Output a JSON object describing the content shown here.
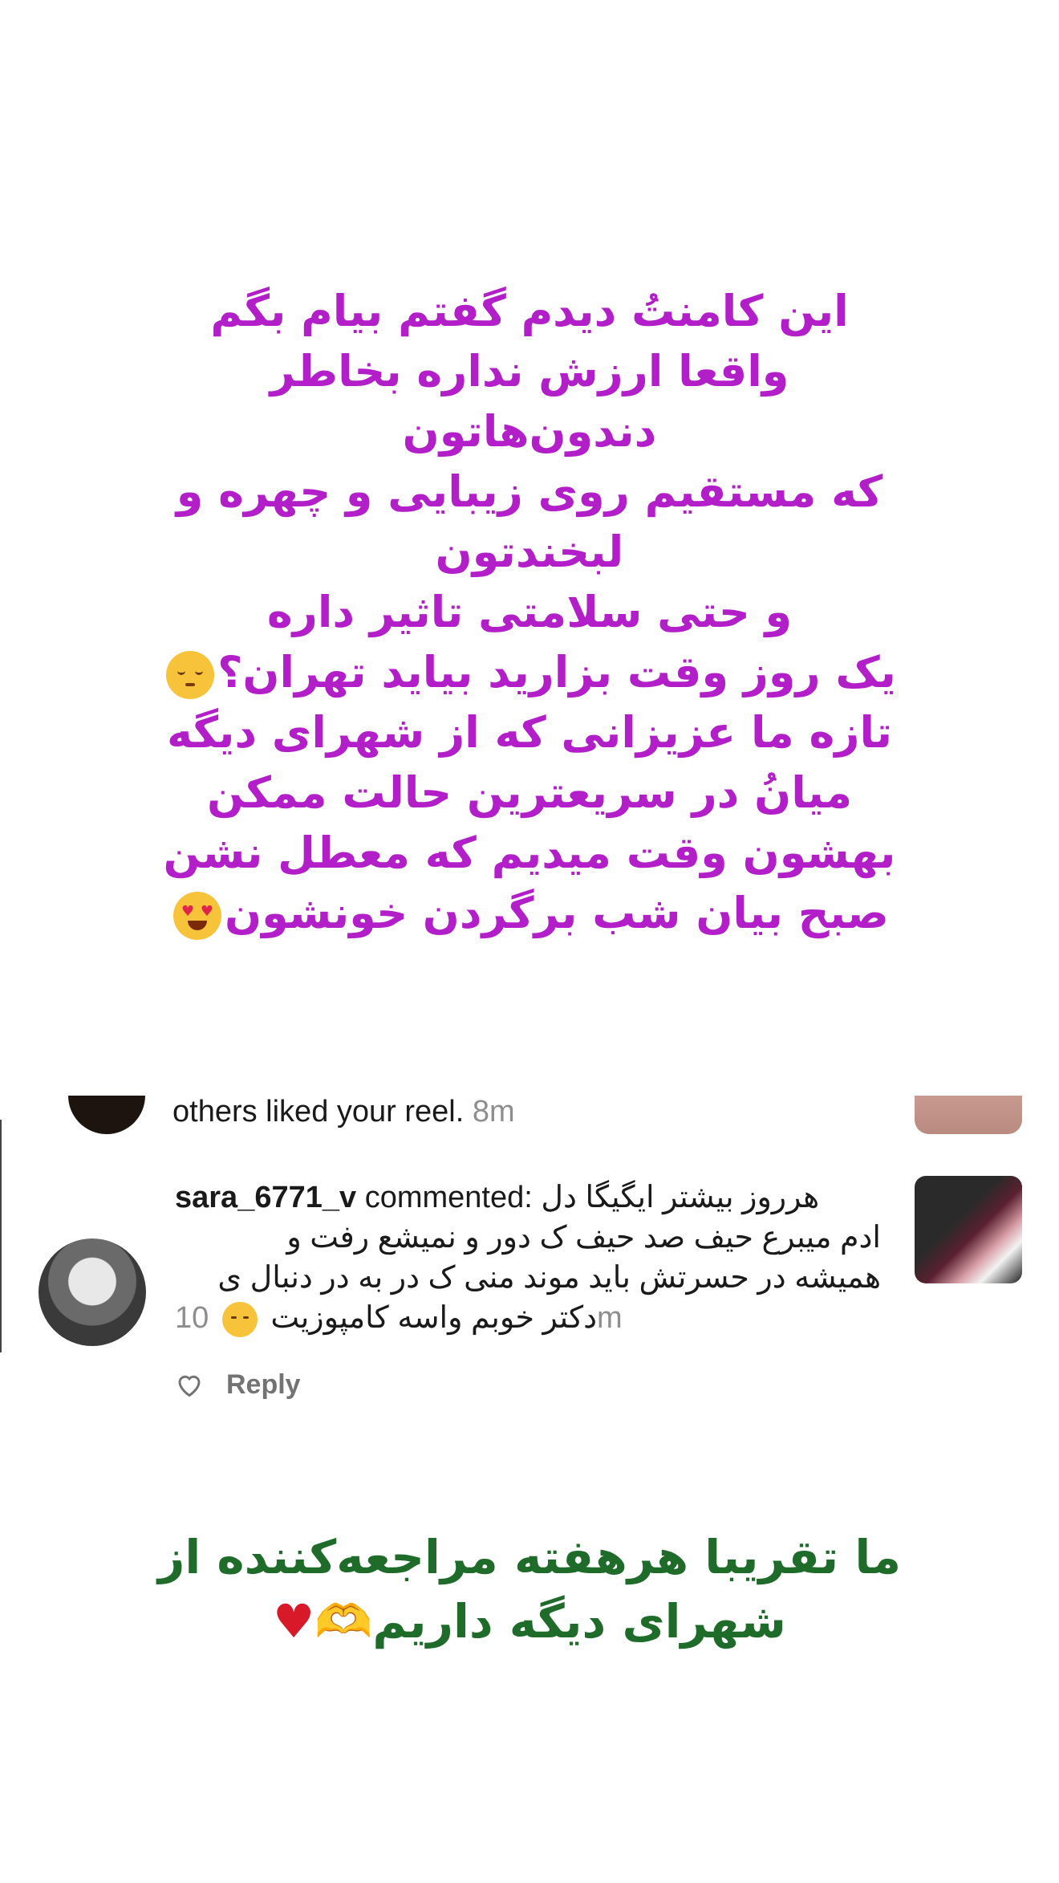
{
  "top_message": {
    "color": "#b21fc8",
    "lines": [
      "این کامنتُ دیدم گفتم بیام بگم",
      "واقعا ارزش نداره بخاطر دندون‌هاتون",
      "که مستقیم روی زیبایی و چهره و",
      "لبخندتون",
      "و حتی سلامتی تاثیر داره",
      "یک روز وقت بزارید بیاید تهران؟",
      "تازه ما عزیزانی که از شهرای دیگه",
      "میانُ در سریعترین حالت ممکن",
      "بهشون وقت میدیم که معطل نشن",
      "صبح بیان شب برگردن خونشون"
    ],
    "emoji_line6": "exhale-face-emoji",
    "emoji_line10": "heart-eyes-emoji"
  },
  "notifications": {
    "previous": {
      "text": "others liked your reel.",
      "time": "8m"
    },
    "comment": {
      "username": "sara_6771_v",
      "action": "commented:",
      "line1": "هرروز بیشتر ایگیگا دل",
      "line2": "ادم میبرع حیف صد حیف ک دور و نمیشع رفت و",
      "line3": "همیشه در حسرتش باید موند منی ک در به در دنبال ی",
      "line4": "دکتر خوبم واسه کامپوزیت",
      "emoji": "disappointed-face-emoji",
      "time": "10m"
    },
    "reply_label": "Reply"
  },
  "bottom_message": {
    "color": "#1f6b2a",
    "lines": [
      "ما تقریبا هرهفته مراجعه‌کننده از",
      "شهرای دیگه داریم"
    ],
    "emojis_line2": "heart-hands-emoji red-heart-emoji"
  }
}
